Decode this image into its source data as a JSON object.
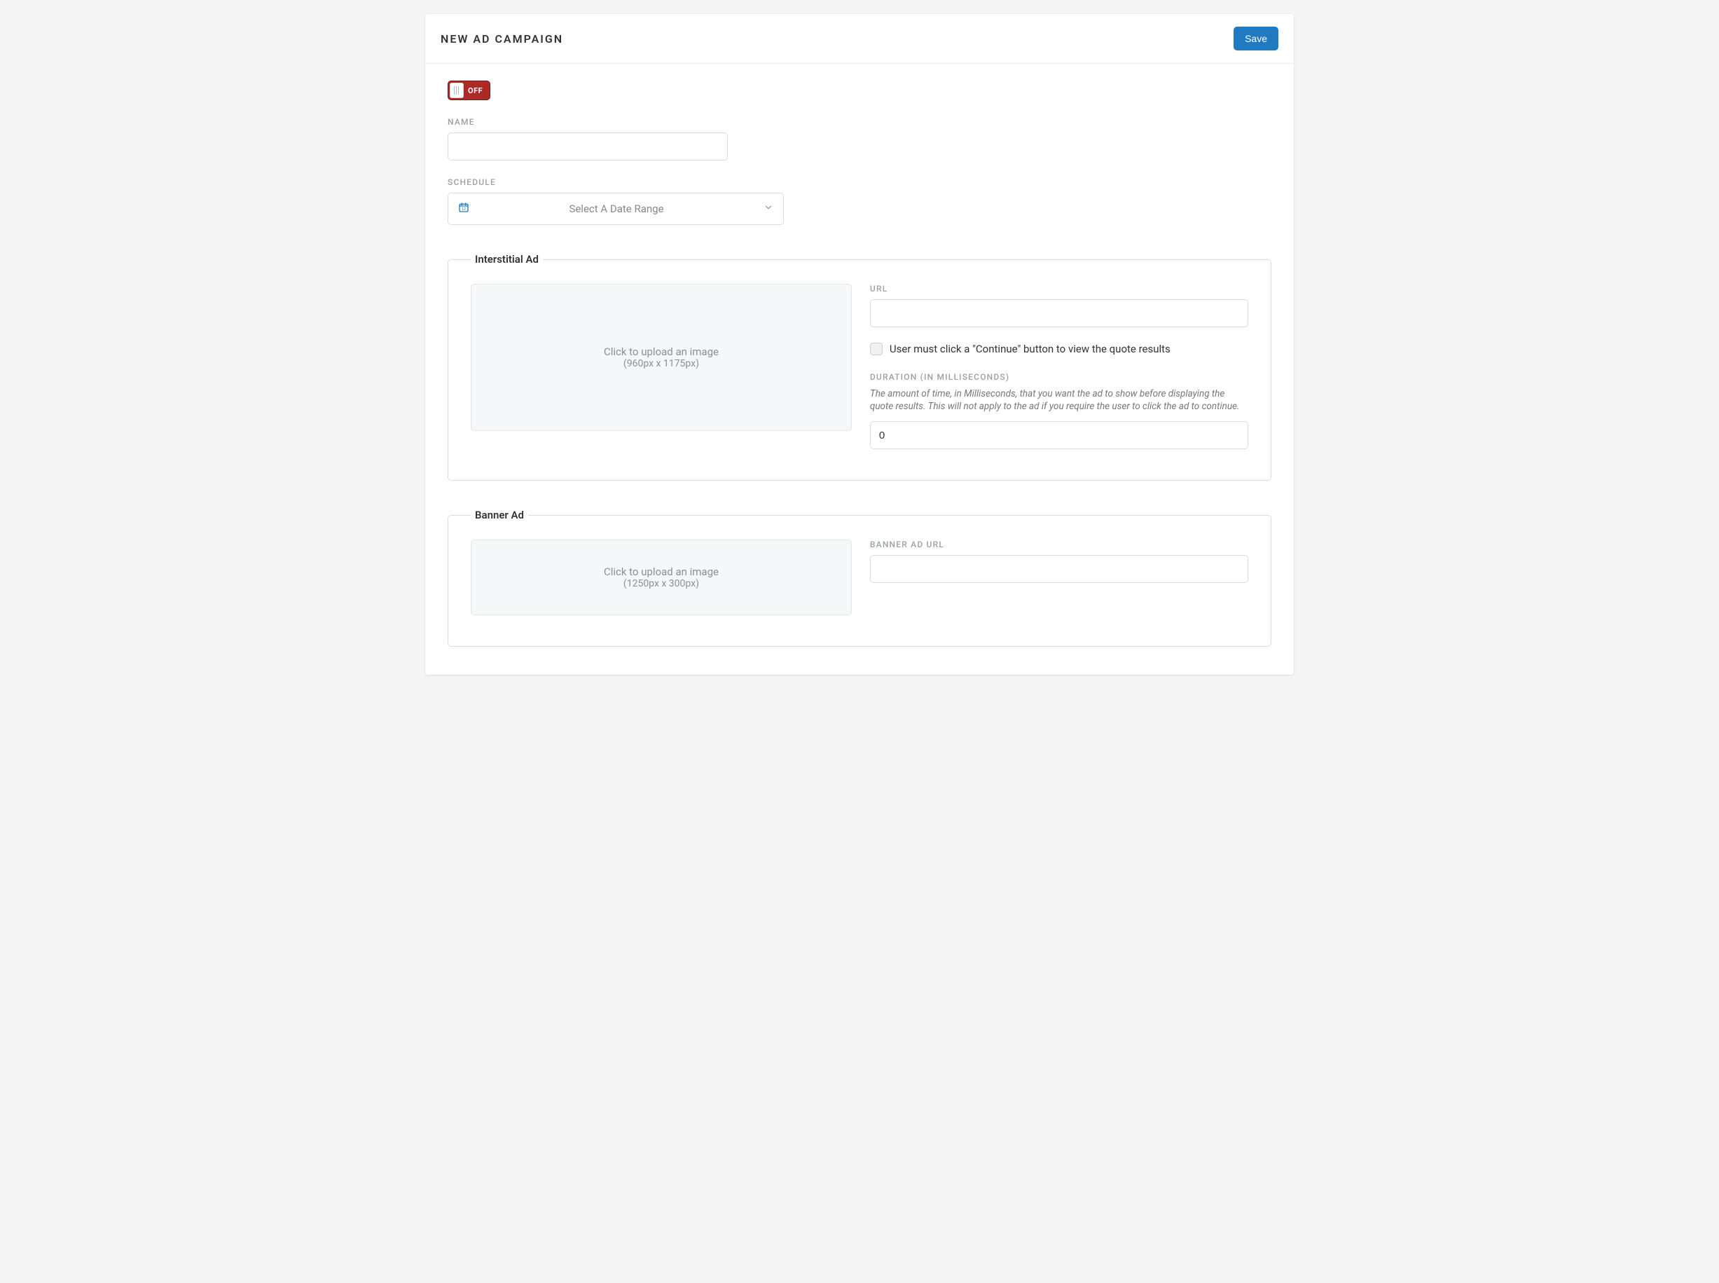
{
  "header": {
    "title": "NEW AD CAMPAIGN",
    "save_label": "Save"
  },
  "toggle": {
    "state_label": "OFF"
  },
  "name_field": {
    "label": "NAME",
    "value": ""
  },
  "schedule": {
    "label": "SCHEDULE",
    "placeholder": "Select A Date Range"
  },
  "interstitial": {
    "legend": "Interstitial Ad",
    "upload_line1": "Click to upload an image",
    "upload_line2": "(960px x 1175px)",
    "url": {
      "label": "URL",
      "value": ""
    },
    "continue_checkbox": {
      "label": "User must click a \"Continue\" button to view the quote results",
      "checked": false
    },
    "duration": {
      "label": "DURATION (IN MILLISECONDS)",
      "help": "The amount of time, in Milliseconds, that you want the ad to show before displaying the quote results. This will not apply to the ad if you require the user to click the ad to continue.",
      "value": "0"
    }
  },
  "banner": {
    "legend": "Banner Ad",
    "upload_line1": "Click to upload an image",
    "upload_line2": "(1250px x 300px)",
    "url": {
      "label": "BANNER AD URL",
      "value": ""
    }
  }
}
